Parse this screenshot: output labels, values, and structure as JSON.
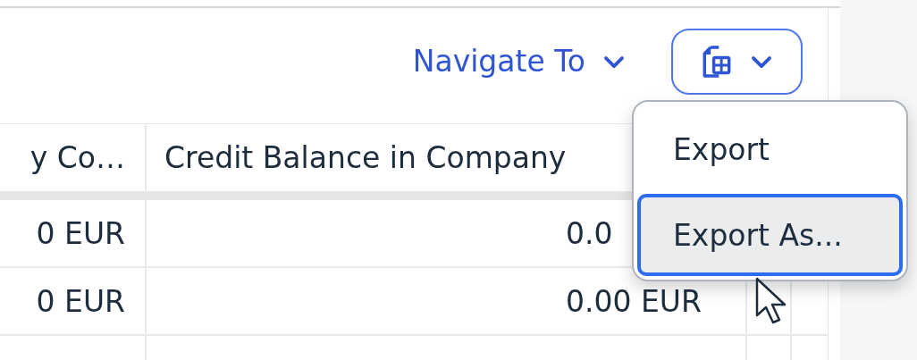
{
  "toolbar": {
    "navigate_button": {
      "label": "Navigate To"
    },
    "export_button": {
      "menu_open": true
    }
  },
  "table": {
    "columns": [
      "y Co…",
      "Credit Balance in Company"
    ],
    "rows": [
      [
        "0 EUR",
        "0.0"
      ],
      [
        "0 EUR",
        "0.00 EUR"
      ]
    ]
  },
  "menu": {
    "items": [
      {
        "label": "Export",
        "selected": false
      },
      {
        "label": "Export As...",
        "selected": true
      }
    ]
  }
}
